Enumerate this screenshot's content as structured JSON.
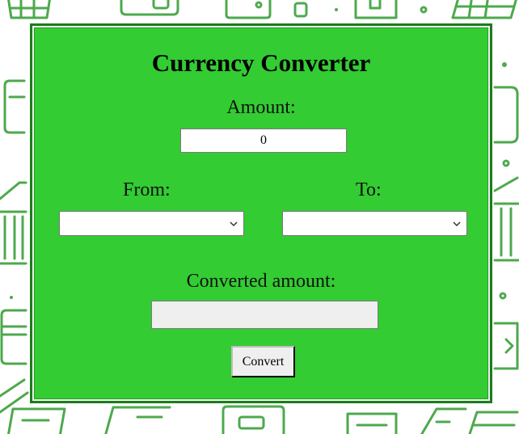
{
  "converter": {
    "title": "Currency Converter",
    "amount_label": "Amount:",
    "amount_value": "0",
    "from_label": "From:",
    "from_selected": "",
    "to_label": "To:",
    "to_selected": "",
    "converted_label": "Converted amount:",
    "converted_value": "",
    "convert_button": "Convert"
  },
  "theme": {
    "panel_color": "#33cc33",
    "pattern_color": "#2f9b2f"
  }
}
